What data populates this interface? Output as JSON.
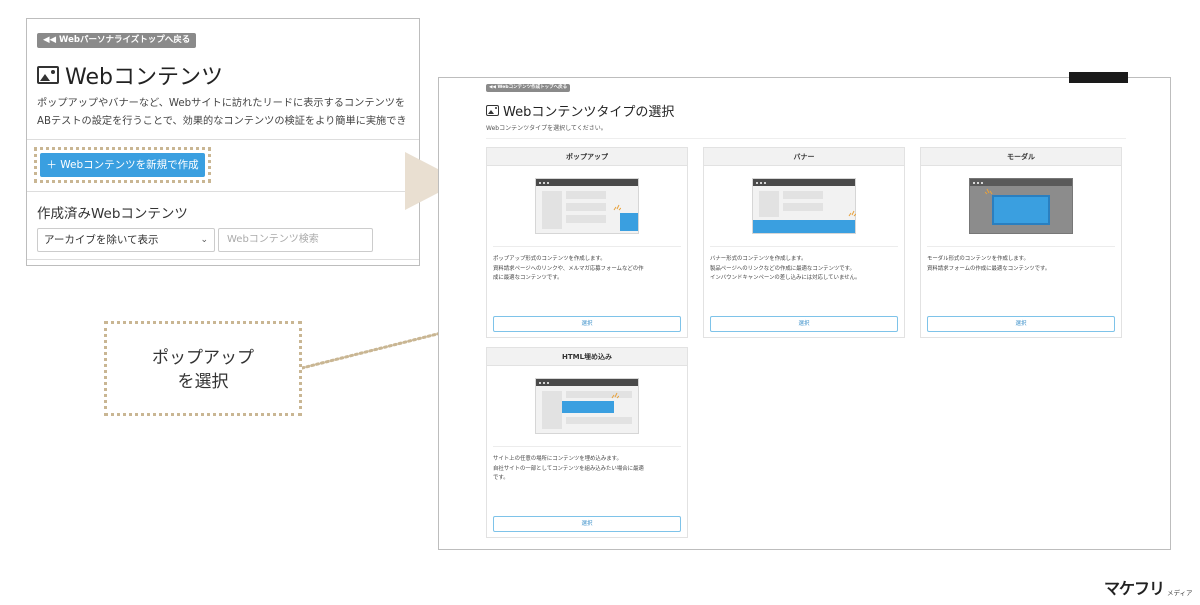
{
  "left_panel": {
    "back_link": "◀◀ Webパーソナライズトップへ戻る",
    "title": "Webコンテンツ",
    "description": [
      "ポップアップやバナーなど、Webサイトに訪れたリードに表示するコンテンツを",
      "ABテストの設定を行うことで、効果的なコンテンツの検証をより簡単に実施でき"
    ],
    "create_button": "＋ Webコンテンツを新規で作成",
    "section_title": "作成済みWebコンテンツ",
    "filter_select": "アーカイブを除いて表示",
    "search_placeholder": "Webコンテンツ検索"
  },
  "callout": {
    "lines": [
      "ポップアップ",
      "を選択"
    ]
  },
  "right_panel": {
    "back_link": "◀◀ Webコンテンツ作成トップへ戻る",
    "title": "Webコンテンツタイプの選択",
    "description": "Webコンテンツタイプを選択してください。",
    "cards": [
      {
        "title": "ポップアップ",
        "illustration": "popup",
        "description": [
          "ポップアップ形式のコンテンツを作成します。",
          "資料請求ページへのリンクや、メルマガ応募フォームなどの作",
          "成に最適なコンテンツです。"
        ],
        "button": "選択"
      },
      {
        "title": "バナー",
        "illustration": "banner",
        "description": [
          "バナー形式のコンテンツを作成します。",
          "製品ページへのリンクなどの作成に最適なコンテンツです。",
          "インバウンドキャンペーンの差し込みには対応していません。"
        ],
        "button": "選択"
      },
      {
        "title": "モーダル",
        "illustration": "modal",
        "description": [
          "モーダル形式のコンテンツを作成します。",
          "資料請求フォームの作成に最適なコンテンツです。"
        ],
        "button": "選択"
      },
      {
        "title": "HTML埋め込み",
        "illustration": "embed",
        "description": [
          "サイト上の任意の場所にコンテンツを埋め込みます。",
          "自社サイトの一部としてコンテンツを組み込みたい場合に最適",
          "です。"
        ],
        "button": "選択"
      }
    ]
  },
  "logo": {
    "main": "マケフリ",
    "sub": "メディア"
  },
  "colors": {
    "accent_blue": "#3a9fe0",
    "highlight_dotted": "#c9b693",
    "arrow": "#e9dfd1",
    "back_chip": "#8a8a8a"
  }
}
